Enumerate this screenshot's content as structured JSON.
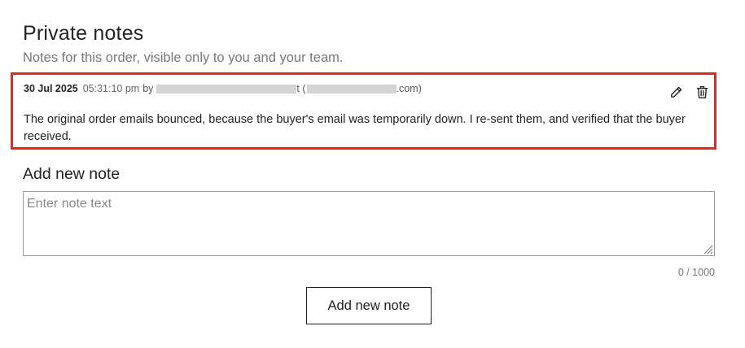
{
  "header": {
    "title": "Private notes",
    "subtitle": "Notes for this order, visible only to you and your team."
  },
  "note": {
    "date": "30 Jul 2025",
    "time": "05:31:10 pm",
    "by_label": "by",
    "author_suffix": "t (",
    "email_suffix": ".com)",
    "body": "The original order emails bounced, because the buyer's email was temporarily down. I re-sent them, and verified that the buyer received.",
    "edit_icon": "pencil-icon",
    "delete_icon": "trash-icon",
    "highlight_color": "#e8261a"
  },
  "add_note": {
    "heading": "Add new note",
    "placeholder": "Enter note text",
    "value": "",
    "char_count": "0 / 1000",
    "button_label": "Add new note"
  }
}
